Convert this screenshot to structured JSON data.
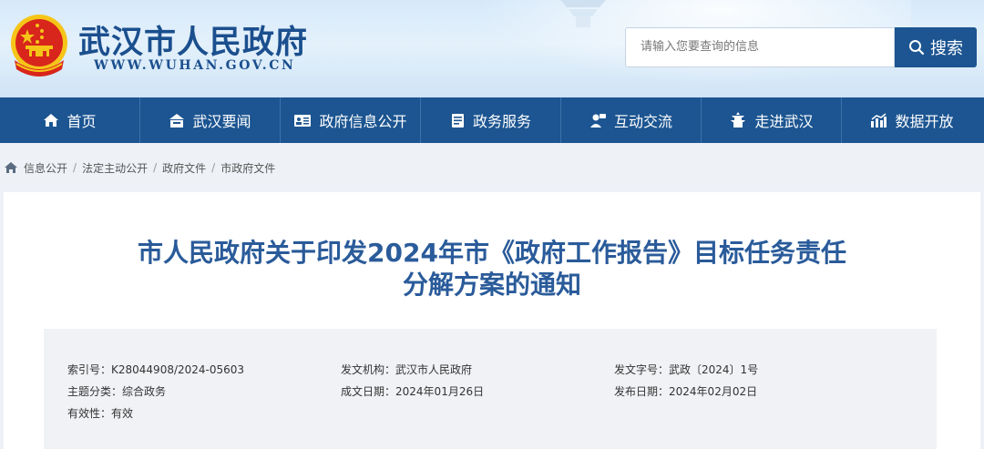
{
  "header": {
    "site_title": "武汉市人民政府",
    "site_url": "WWW.WUHAN.GOV.CN",
    "search_placeholder": "请输入您要查询的信息",
    "search_label": "搜索"
  },
  "nav": {
    "items": [
      {
        "label": "首页",
        "icon": "home-icon"
      },
      {
        "label": "武汉要闻",
        "icon": "news-icon"
      },
      {
        "label": "政府信息公开",
        "icon": "id-card-icon"
      },
      {
        "label": "政务服务",
        "icon": "document-icon"
      },
      {
        "label": "互动交流",
        "icon": "chat-icon"
      },
      {
        "label": "走进武汉",
        "icon": "landmark-icon"
      },
      {
        "label": "数据开放",
        "icon": "chart-icon"
      }
    ]
  },
  "breadcrumb": {
    "items": [
      "信息公开",
      "法定主动公开",
      "政府文件",
      "市政府文件"
    ],
    "separator": "/"
  },
  "document": {
    "title_line1": "市人民政府关于印发2024年市《政府工作报告》目标任务责任",
    "title_line2": "分解方案的通知",
    "meta": {
      "index_label": "索引号：",
      "index_value": "K28044908/2024-05603",
      "org_label": "发文机构：",
      "org_value": "武汉市人民政府",
      "docno_label": "发文字号：",
      "docno_value": "武政〔2024〕1号",
      "topic_label": "主题分类：",
      "topic_value": "综合政务",
      "created_label": "成文日期：",
      "created_value": "2024年01月26日",
      "published_label": "发布日期：",
      "published_value": "2024年02月02日",
      "validity_label": "有效性：",
      "validity_value": "有效"
    }
  },
  "colors": {
    "brand": "#1c5591",
    "title": "#2a5b9a",
    "emblem_red": "#d8261c",
    "emblem_gold": "#f5c518"
  }
}
